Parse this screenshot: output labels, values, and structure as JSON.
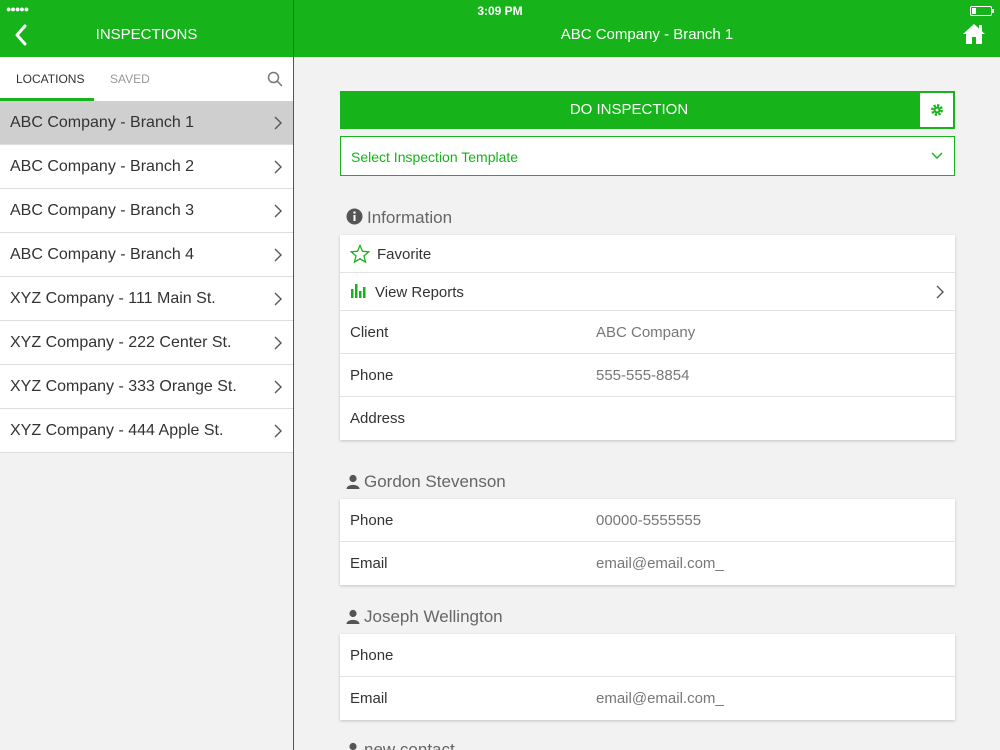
{
  "status_bar": {
    "signal": "●●●●●",
    "time": "3:09 PM"
  },
  "left_header": {
    "title": "INSPECTIONS"
  },
  "right_header": {
    "title": "ABC Company - Branch 1"
  },
  "tabs": [
    {
      "label": "LOCATIONS",
      "active": true
    },
    {
      "label": "SAVED",
      "active": false
    }
  ],
  "locations": [
    {
      "label": "ABC Company - Branch 1",
      "selected": true
    },
    {
      "label": "ABC Company - Branch 2",
      "selected": false
    },
    {
      "label": "ABC Company - Branch 3",
      "selected": false
    },
    {
      "label": "ABC Company - Branch 4",
      "selected": false
    },
    {
      "label": "XYZ Company - 111 Main St.",
      "selected": false
    },
    {
      "label": "XYZ Company - 222 Center St.",
      "selected": false
    },
    {
      "label": "XYZ Company - 333 Orange St.",
      "selected": false
    },
    {
      "label": "XYZ Company - 444 Apple St.",
      "selected": false
    }
  ],
  "actions": {
    "do_inspection": "DO INSPECTION",
    "template_placeholder": "Select Inspection Template"
  },
  "information": {
    "title": "Information",
    "favorite": "Favorite",
    "view_reports": "View Reports",
    "client_label": "Client",
    "client_value": "ABC Company",
    "phone_label": "Phone",
    "phone_value": "555-555-8854",
    "address_label": "Address",
    "address_value": ""
  },
  "contacts": [
    {
      "name": "Gordon Stevenson",
      "phone_label": "Phone",
      "phone": "00000-5555555",
      "email_label": "Email",
      "email": "email@email.com_"
    },
    {
      "name": "Joseph Wellington",
      "phone_label": "Phone",
      "phone": "",
      "email_label": "Email",
      "email": "email@email.com_"
    }
  ],
  "partial_section": "new contact",
  "colors": {
    "accent": "#17b31b",
    "selected_row": "#cfcfcf",
    "background": "#f2f2f2"
  }
}
